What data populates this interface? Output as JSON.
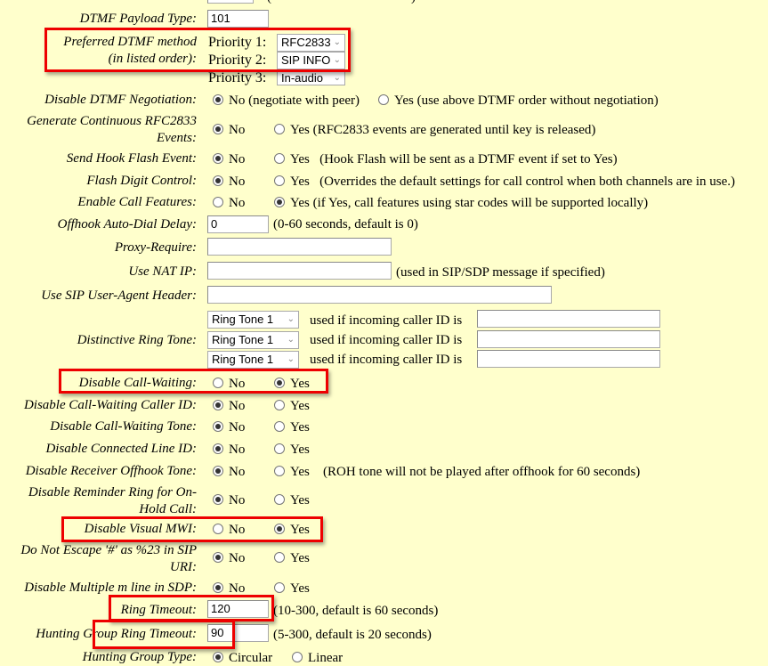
{
  "top_partial": {
    "note": "(",
    "note_end": ")"
  },
  "dtmf_payload": {
    "label": "DTMF Payload Type:",
    "value": "101"
  },
  "preferred_dtmf": {
    "label_line1": "Preferred DTMF method",
    "label_line2": "(in listed order):",
    "priorities": [
      {
        "label": "Priority 1:",
        "value": "RFC2833"
      },
      {
        "label": "Priority 2:",
        "value": "SIP INFO"
      },
      {
        "label": "Priority 3:",
        "value": "In-audio"
      }
    ]
  },
  "disable_dtmf_negotiation": {
    "label": "Disable DTMF Negotiation:",
    "no": "No (negotiate with peer)",
    "yes": "Yes (use above DTMF order without negotiation)",
    "selected": "no"
  },
  "continuous_rfc2833": {
    "label_line1": "Generate Continuous RFC2833",
    "label_line2": "Events:",
    "no": "No",
    "yes": "Yes (RFC2833 events are generated until key is released)",
    "selected": "no"
  },
  "hook_flash": {
    "label": "Send Hook Flash Event:",
    "no": "No",
    "yes": "Yes   (Hook Flash will be sent as a DTMF event if set to Yes)",
    "selected": "no"
  },
  "flash_digit": {
    "label": "Flash Digit Control:",
    "no": "No",
    "yes": "Yes   (Overrides the default settings for call control when both channels are in use.)",
    "selected": "no"
  },
  "call_features": {
    "label": "Enable Call Features:",
    "no": "No",
    "yes": "Yes (if Yes, call features using star codes will be supported locally)",
    "selected": "yes"
  },
  "offhook_delay": {
    "label": "Offhook Auto-Dial Delay:",
    "value": "0",
    "hint": "(0-60 seconds, default is 0)"
  },
  "proxy_require": {
    "label": "Proxy-Require:",
    "value": ""
  },
  "nat_ip": {
    "label": "Use NAT IP:",
    "value": "",
    "hint": "(used in SIP/SDP message if specified)"
  },
  "user_agent": {
    "label": "Use SIP User-Agent Header:",
    "value": ""
  },
  "distinctive_ring": {
    "label": "Distinctive Ring Tone:",
    "text": "used if incoming caller ID is",
    "rows": [
      {
        "tone": "Ring Tone 1",
        "caller_id": ""
      },
      {
        "tone": "Ring Tone 1",
        "caller_id": ""
      },
      {
        "tone": "Ring Tone 1",
        "caller_id": ""
      }
    ]
  },
  "disable_cw": {
    "label": "Disable Call-Waiting:",
    "no": "No",
    "yes": "Yes",
    "selected": "yes"
  },
  "disable_cw_cid": {
    "label": "Disable Call-Waiting Caller ID:",
    "no": "No",
    "yes": "Yes",
    "selected": "no"
  },
  "disable_cw_tone": {
    "label": "Disable Call-Waiting Tone:",
    "no": "No",
    "yes": "Yes",
    "selected": "no"
  },
  "disable_cli": {
    "label": "Disable Connected Line ID:",
    "no": "No",
    "yes": "Yes",
    "selected": "no"
  },
  "disable_roh": {
    "label": "Disable Receiver Offhook Tone:",
    "no": "No",
    "yes": "Yes",
    "hint": "(ROH tone will not be played after offhook for 60 seconds)",
    "selected": "no"
  },
  "reminder_ring": {
    "label_line1": "Disable Reminder Ring for On-",
    "label_line2": "Hold Call:",
    "no": "No",
    "yes": "Yes",
    "selected": "no"
  },
  "visual_mwi": {
    "label": "Disable Visual MWI:",
    "no": "No",
    "yes": "Yes",
    "selected": "yes"
  },
  "escape_hash": {
    "label_line1": "Do Not Escape '#' as %23 in SIP",
    "label_line2": "URI:",
    "no": "No",
    "yes": "Yes",
    "selected": "no"
  },
  "multiple_m": {
    "label": "Disable Multiple m line in SDP:",
    "no": "No",
    "yes": "Yes",
    "selected": "no"
  },
  "ring_timeout": {
    "label": "Ring Timeout:",
    "value": "120",
    "hint": "(10-300, default is 60 seconds)"
  },
  "hunt_ring_timeout": {
    "label": "Hunting Group Ring Timeout:",
    "value": "90",
    "hint": "(5-300, default is 20 seconds)"
  },
  "hunt_type": {
    "label": "Hunting Group Type:",
    "opt1": "Circular",
    "opt2": "Linear",
    "selected": "opt1"
  },
  "colors": {
    "background": "#ffffcc",
    "highlight": "#ee0000"
  }
}
